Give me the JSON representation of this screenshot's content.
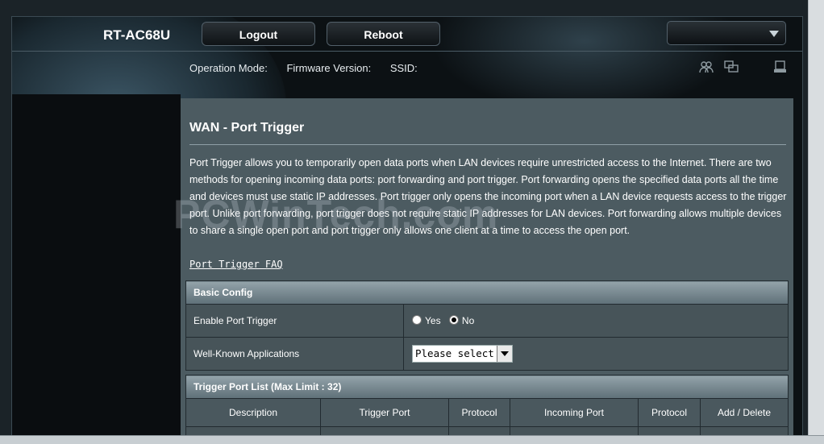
{
  "header": {
    "model": "RT-AC68U",
    "logout_label": "Logout",
    "reboot_label": "Reboot"
  },
  "infobar": {
    "operation_mode": "Operation Mode:",
    "firmware_version": "Firmware Version:",
    "ssid": "SSID:"
  },
  "icons": [
    "clients-icon",
    "network-map-icon",
    "usb-device-icon"
  ],
  "panel": {
    "title": "WAN - Port Trigger",
    "description": "Port Trigger allows you to temporarily open data ports when LAN devices require unrestricted access to the Internet. There are two methods for opening incoming data ports: port forwarding and port trigger. Port forwarding opens the specified data ports all the time and devices must use static IP addresses. Port trigger only opens the incoming port when a LAN device requests access to the trigger port. Unlike port forwarding, port trigger does not require static IP addresses for LAN devices. Port forwarding allows multiple devices to share a single open port and port trigger only allows one client at a time to access the open port.",
    "faq_link": "Port Trigger FAQ",
    "watermark": "PCWinTech.com"
  },
  "basic_config": {
    "header": "Basic Config",
    "enable_label": "Enable Port Trigger",
    "yes_label": "Yes",
    "no_label": "No",
    "selected": "No",
    "apps_label": "Well-Known Applications",
    "apps_value": "Please select"
  },
  "trigger_list": {
    "header": "Trigger Port List (Max Limit : 32)",
    "columns": [
      "Description",
      "Trigger Port",
      "Protocol",
      "Incoming Port",
      "Protocol",
      "Add / Delete"
    ]
  }
}
